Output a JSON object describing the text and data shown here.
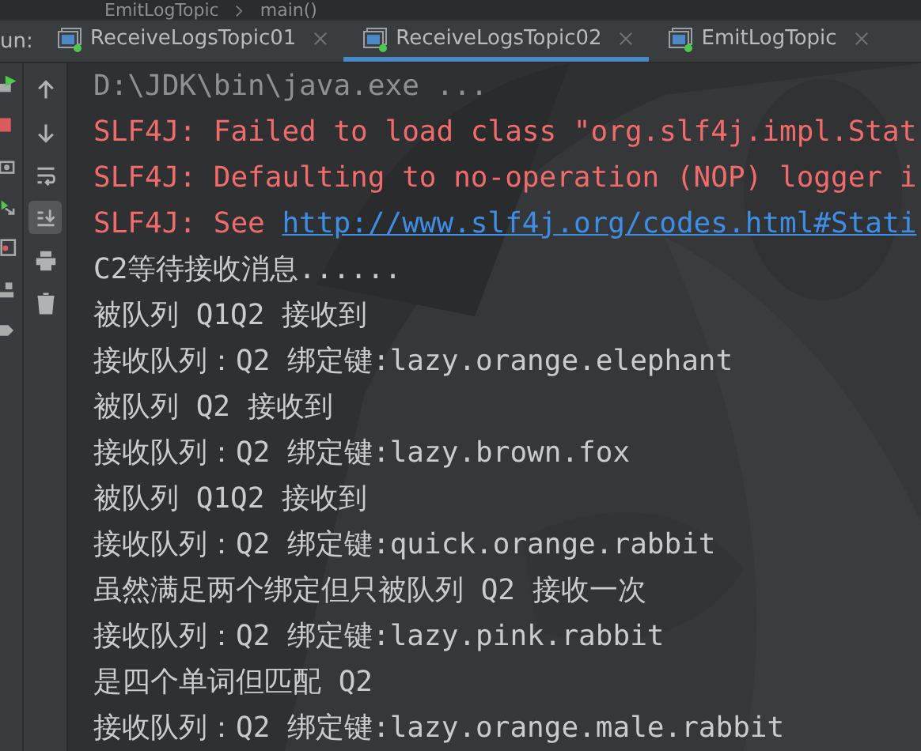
{
  "breadcrumb": {
    "file": "EmitLogTopic",
    "method": "main()"
  },
  "run_label": "un:",
  "tabs": [
    {
      "label": "ReceiveLogsTopic01",
      "selected": false
    },
    {
      "label": "ReceiveLogsTopic02",
      "selected": true
    },
    {
      "label": "EmitLogTopic",
      "selected": false
    }
  ],
  "toolbar": [
    {
      "kind": "up",
      "selected": false
    },
    {
      "kind": "down",
      "selected": false
    },
    {
      "kind": "wrap",
      "selected": false
    },
    {
      "kind": "scroll-end",
      "selected": true
    },
    {
      "kind": "print",
      "selected": false
    },
    {
      "kind": "trash",
      "selected": false
    }
  ],
  "console": [
    {
      "kind": "command",
      "text": "D:\\JDK\\bin\\java.exe ..."
    },
    {
      "kind": "error",
      "text": "SLF4J: Failed to load class \"org.slf4j.impl.Stat"
    },
    {
      "kind": "error",
      "text": "SLF4J: Defaulting to no-operation (NOP) logger i"
    },
    {
      "kind": "error-link",
      "text": "SLF4J: See ",
      "link": "http://www.slf4j.org/codes.html#Stati"
    },
    {
      "kind": "output",
      "text": "C2等待接收消息......"
    },
    {
      "kind": "output",
      "text": "被队列 Q1Q2 接收到"
    },
    {
      "kind": "output",
      "text": "接收队列：Q2 绑定键:lazy.orange.elephant"
    },
    {
      "kind": "output",
      "text": "被队列 Q2 接收到"
    },
    {
      "kind": "output",
      "text": "接收队列：Q2 绑定键:lazy.brown.fox"
    },
    {
      "kind": "output",
      "text": "被队列 Q1Q2 接收到"
    },
    {
      "kind": "output",
      "text": "接收队列：Q2 绑定键:quick.orange.rabbit"
    },
    {
      "kind": "output",
      "text": "虽然满足两个绑定但只被队列 Q2 接收一次"
    },
    {
      "kind": "output",
      "text": "接收队列：Q2 绑定键:lazy.pink.rabbit"
    },
    {
      "kind": "output",
      "text": "是四个单词但匹配 Q2"
    },
    {
      "kind": "output",
      "text": "接收队列：Q2 绑定键:lazy.orange.male.rabbit"
    }
  ]
}
